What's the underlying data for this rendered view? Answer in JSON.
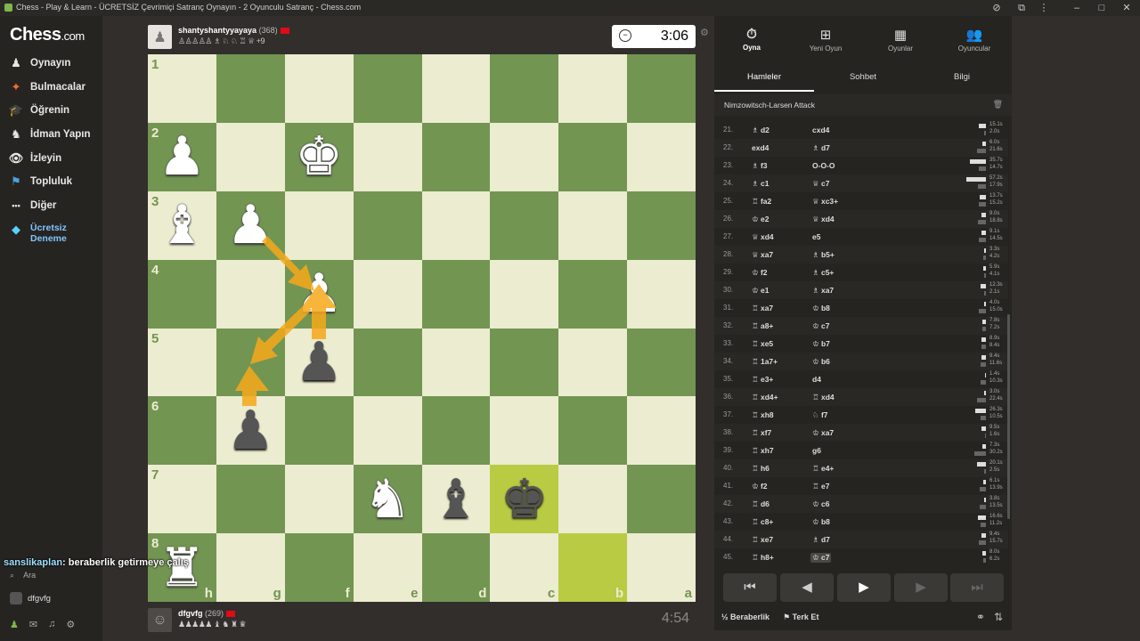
{
  "window": {
    "title": "Chess - Play & Learn - ÜCRETSİZ Çevrimiçi Satranç Oynayın - 2 Oyunculu Satranç - Chess.com"
  },
  "sidebar": {
    "logo": "Chess",
    "logo_suffix": ".com",
    "items": [
      {
        "label": "Oynayın",
        "icon": "♟"
      },
      {
        "label": "Bulmacalar",
        "icon": "✦"
      },
      {
        "label": "Öğrenin",
        "icon": "🎓"
      },
      {
        "label": "İdman Yapın",
        "icon": "♞"
      },
      {
        "label": "İzleyin",
        "icon": "👁"
      },
      {
        "label": "Topluluk",
        "icon": "⚑"
      },
      {
        "label": "Diğer",
        "icon": "•••"
      }
    ],
    "trial_line1": "Ücretsiz",
    "trial_line2": "Deneme",
    "search_label": "Ara",
    "username": "dfgvfg"
  },
  "chat_overlay": {
    "name": "sanslikaplan",
    "message": ": beraberlik getirmeye çalış"
  },
  "top_player": {
    "name": "shantyshantyyayaya",
    "rating": "(368)",
    "captured": "♙♙♙♙♙ ♗ ♘ ♘ ♖ ♕",
    "advantage": "+9",
    "clock": "3:06"
  },
  "bottom_player": {
    "name": "dfgvfg",
    "rating": "(269)",
    "captured": "♟♟♟♟♟ ♝ ♞ ♜ ♛",
    "clock": "4:54"
  },
  "board": {
    "ranks": [
      "1",
      "2",
      "3",
      "4",
      "5",
      "6",
      "7",
      "8"
    ],
    "files": [
      "h",
      "g",
      "f",
      "e",
      "d",
      "c",
      "b",
      "a"
    ],
    "pieces": [
      {
        "r": 1,
        "c": 0,
        "p": "♟",
        "color": "w"
      },
      {
        "r": 1,
        "c": 2,
        "p": "♚",
        "color": "w"
      },
      {
        "r": 2,
        "c": 0,
        "p": "♝",
        "color": "w"
      },
      {
        "r": 2,
        "c": 1,
        "p": "♟",
        "color": "w"
      },
      {
        "r": 3,
        "c": 2,
        "p": "♟",
        "color": "w"
      },
      {
        "r": 4,
        "c": 2,
        "p": "♟",
        "color": "b"
      },
      {
        "r": 5,
        "c": 1,
        "p": "♟",
        "color": "b"
      },
      {
        "r": 6,
        "c": 3,
        "p": "♞",
        "color": "w"
      },
      {
        "r": 6,
        "c": 4,
        "p": "♝",
        "color": "b"
      },
      {
        "r": 6,
        "c": 5,
        "p": "♚",
        "color": "b"
      },
      {
        "r": 7,
        "c": 0,
        "p": "♜",
        "color": "w"
      }
    ],
    "highlights": [
      {
        "r": 6,
        "c": 5
      },
      {
        "r": 7,
        "c": 6
      }
    ]
  },
  "right_panel": {
    "top_tabs": [
      {
        "label": "Oyna",
        "icon": "⏱"
      },
      {
        "label": "Yeni Oyun",
        "icon": "⊞"
      },
      {
        "label": "Oyunlar",
        "icon": "▦"
      },
      {
        "label": "Oyuncular",
        "icon": "👥"
      }
    ],
    "sub_tabs": [
      "Hamleler",
      "Sohbet",
      "Bilgi"
    ],
    "opening": "Nimzowitsch-Larsen Attack",
    "moves": [
      {
        "n": "21.",
        "w": "♗ d2",
        "b": "cxd4",
        "tw": "15.1s",
        "tb": "2.0s",
        "ww": 8,
        "wb": 2
      },
      {
        "n": "22.",
        "w": "exd4",
        "b": "♗ d7",
        "tw": "6.0s",
        "tb": "21.6s",
        "ww": 4,
        "wb": 10
      },
      {
        "n": "23.",
        "w": "♗ f3",
        "b": "O-O-O",
        "tw": "35.7s",
        "tb": "14.7s",
        "ww": 18,
        "wb": 8
      },
      {
        "n": "24.",
        "w": "♗ c1",
        "b": "♕ c7",
        "tw": "57.2s",
        "tb": "17.9s",
        "ww": 22,
        "wb": 9
      },
      {
        "n": "25.",
        "w": "♖ fa2",
        "b": "♕ xc3+",
        "tw": "13.7s",
        "tb": "15.2s",
        "ww": 7,
        "wb": 8
      },
      {
        "n": "26.",
        "w": "♔ e2",
        "b": "♕ xd4",
        "tw": "9.0s",
        "tb": "18.8s",
        "ww": 5,
        "wb": 9
      },
      {
        "n": "27.",
        "w": "♕ xd4",
        "b": "e5",
        "tw": "9.1s",
        "tb": "14.5s",
        "ww": 5,
        "wb": 8
      },
      {
        "n": "28.",
        "w": "♕ xa7",
        "b": "♗ b5+",
        "tw": "3.3s",
        "tb": "4.2s",
        "ww": 2,
        "wb": 3
      },
      {
        "n": "29.",
        "w": "♔ f2",
        "b": "♗ c5+",
        "tw": "5.9s",
        "tb": "4.1s",
        "ww": 3,
        "wb": 2
      },
      {
        "n": "30.",
        "w": "♔ e1",
        "b": "♗ xa7",
        "tw": "12.3s",
        "tb": "2.1s",
        "ww": 6,
        "wb": 2
      },
      {
        "n": "31.",
        "w": "♖ xa7",
        "b": "♔ b8",
        "tw": "4.0s",
        "tb": "15.0s",
        "ww": 2,
        "wb": 8
      },
      {
        "n": "32.",
        "w": "♖ a8+",
        "b": "♔ c7",
        "tw": "7.8s",
        "tb": "7.2s",
        "ww": 4,
        "wb": 4
      },
      {
        "n": "33.",
        "w": "♖ xe5",
        "b": "♔ b7",
        "tw": "8.9s",
        "tb": "8.4s",
        "ww": 5,
        "wb": 5
      },
      {
        "n": "34.",
        "w": "♖ 1a7+",
        "b": "♔ b6",
        "tw": "9.4s",
        "tb": "11.6s",
        "ww": 5,
        "wb": 6
      },
      {
        "n": "35.",
        "w": "♖ e3+",
        "b": "d4",
        "tw": "1.4s",
        "tb": "10.3s",
        "ww": 1,
        "wb": 6
      },
      {
        "n": "36.",
        "w": "♖ xd4+",
        "b": "♖ xd4",
        "tw": "3.0s",
        "tb": "22.4s",
        "ww": 2,
        "wb": 10
      },
      {
        "n": "37.",
        "w": "♖ xh8",
        "b": "♘ f7",
        "tw": "26.3s",
        "tb": "10.5s",
        "ww": 12,
        "wb": 6
      },
      {
        "n": "38.",
        "w": "♖ xf7",
        "b": "♔ xa7",
        "tw": "9.5s",
        "tb": "1.6s",
        "ww": 5,
        "wb": 1
      },
      {
        "n": "39.",
        "w": "♖ xh7",
        "b": "g6",
        "tw": "7.3s",
        "tb": "30.2s",
        "ww": 4,
        "wb": 13
      },
      {
        "n": "40.",
        "w": "♖ h6",
        "b": "♖ e4+",
        "tw": "20.1s",
        "tb": "2.5s",
        "ww": 10,
        "wb": 2
      },
      {
        "n": "41.",
        "w": "♔ f2",
        "b": "♖ e7",
        "tw": "6.1s",
        "tb": "13.9s",
        "ww": 3,
        "wb": 7
      },
      {
        "n": "42.",
        "w": "♖ d6",
        "b": "♔ c6",
        "tw": "3.8s",
        "tb": "13.5s",
        "ww": 2,
        "wb": 7
      },
      {
        "n": "43.",
        "w": "♖ c8+",
        "b": "♔ b8",
        "tw": "16.6s",
        "tb": "11.2s",
        "ww": 9,
        "wb": 6
      },
      {
        "n": "44.",
        "w": "♖ xe7",
        "b": "♗ d7",
        "tw": "9.4s",
        "tb": "15.7s",
        "ww": 5,
        "wb": 8
      },
      {
        "n": "45.",
        "w": "♖ h8+",
        "b": "♔ c7",
        "tw": "8.0s",
        "tb": "6.2s",
        "ww": 4,
        "wb": 3
      }
    ],
    "controls": [
      "⏮",
      "◀",
      "▶",
      "▶",
      "⏭"
    ],
    "draw_label": "Beraberlik",
    "draw_icon": "½",
    "resign_label": "Terk Et",
    "resign_icon": "⚑"
  }
}
